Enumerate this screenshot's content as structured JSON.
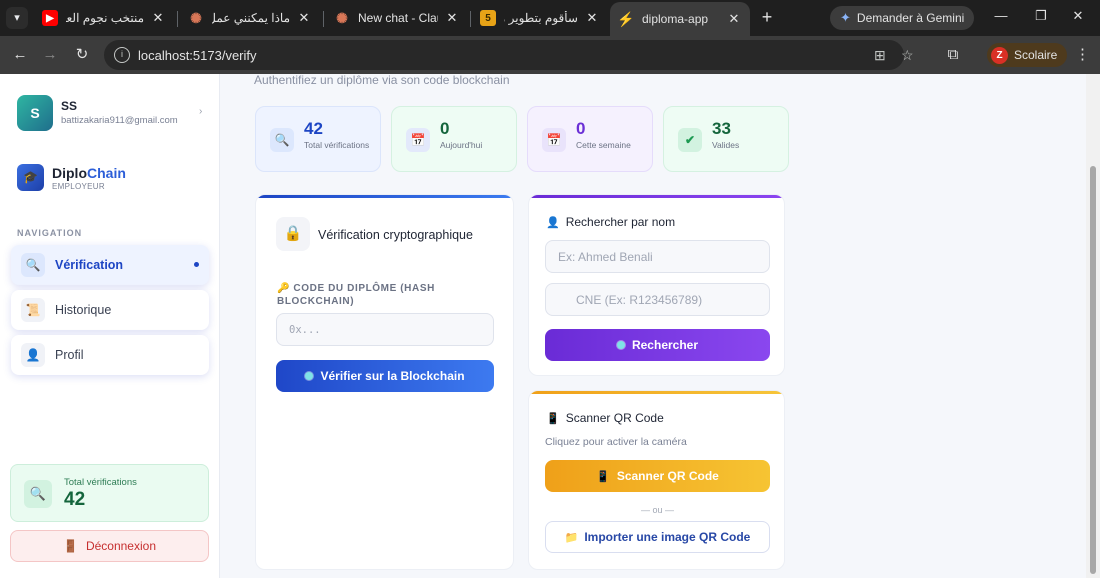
{
  "browser": {
    "tabs": [
      {
        "title": "منتخب نجوم العرب",
        "icon": "youtube-icon",
        "color": "#ff0000"
      },
      {
        "title": "ماذا يمكنني عمل بـ",
        "icon": "claude-icon",
        "color": "#d97757"
      },
      {
        "title": "New chat - Claude",
        "icon": "claude-icon",
        "color": "#d97757"
      },
      {
        "title": "سأقوم بتطوير موقع",
        "icon": "number-five-icon",
        "color": "#e8a317",
        "glyph": "5"
      },
      {
        "title": "diploma-app",
        "icon": "vite-icon",
        "color": "#a259ff"
      }
    ],
    "gemini_label": "Demander à Gemini",
    "url": "localhost:5173/verify",
    "profile": {
      "initial": "Z",
      "name": "Scolaire"
    }
  },
  "sidebar": {
    "user": {
      "initial": "S",
      "name": "SS",
      "email": "battizakaria911@gmail.com"
    },
    "brand": {
      "name_a": "Diplo",
      "name_b": "Chain",
      "role": "EMPLOYEUR"
    },
    "nav_label": "NAVIGATION",
    "nav": [
      {
        "label": "Vérification",
        "icon": "search-icon",
        "active": true
      },
      {
        "label": "Historique",
        "icon": "scroll-icon"
      },
      {
        "label": "Profil",
        "icon": "user-icon"
      }
    ],
    "stat": {
      "label": "Total vérifications",
      "value": "42"
    },
    "logout_label": "Déconnexion"
  },
  "main": {
    "subtitle": "Authentifiez un diplôme via son code blockchain",
    "stats": [
      {
        "value": "42",
        "label": "Total vérifications",
        "icon": "search-icon",
        "color": "#1d45c4"
      },
      {
        "value": "0",
        "label": "Aujourd'hui",
        "icon": "calendar-icon",
        "color": "#14653c"
      },
      {
        "value": "0",
        "label": "Cette semaine",
        "icon": "calendar-icon",
        "color": "#6b2fd6"
      },
      {
        "value": "33",
        "label": "Valides",
        "icon": "checkmark-icon",
        "color": "#14653c"
      }
    ],
    "verify": {
      "title": "Vérification cryptographique",
      "field_label": "🔑 CODE DU DIPLÔME (HASH BLOCKCHAIN)",
      "placeholder": "0x...",
      "button": "Vérifier sur la Blockchain"
    },
    "search": {
      "title": "Rechercher par nom",
      "name_placeholder": "Ex: Ahmed Benali",
      "cne_placeholder": "CNE (Ex: R123456789)",
      "button": "Rechercher"
    },
    "qr": {
      "title": "Scanner QR Code",
      "hint": "Cliquez pour activer la caméra",
      "scan_button": "Scanner QR Code",
      "divider": "— ou —",
      "import_button": "Importer une image QR Code"
    }
  },
  "colors": {
    "primary": "#2c5ed8",
    "purple": "#7b35e8",
    "amber": "#f2b01e",
    "danger": "#c62f2f"
  }
}
